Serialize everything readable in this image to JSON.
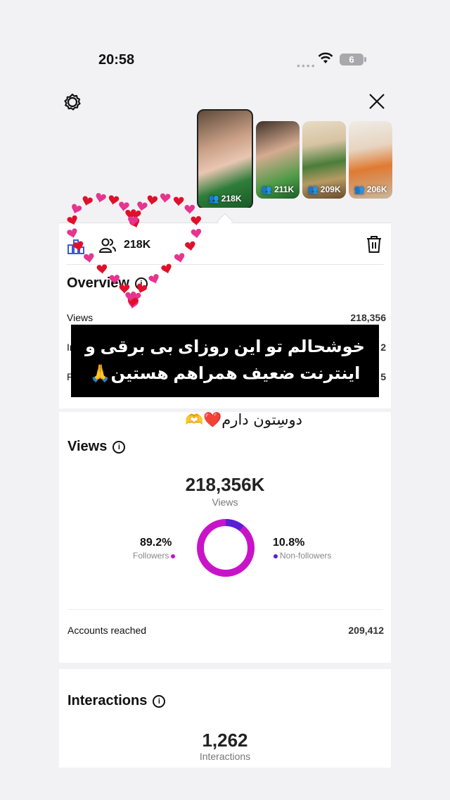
{
  "status_bar": {
    "time": "20:58",
    "signal": "••••",
    "battery": "6"
  },
  "colors": {
    "followers": "#c814c8",
    "non_followers": "#5a1fd6",
    "heart_red": "#e0102a",
    "heart_pink": "#e8338f"
  },
  "thumbnails": [
    {
      "count": "218K",
      "selected": true
    },
    {
      "count": "211K"
    },
    {
      "count": "209K"
    },
    {
      "count": "206K"
    }
  ],
  "tabbar": {
    "reached": "218K"
  },
  "overview": {
    "title": "Overview",
    "rows": [
      {
        "label": "Views",
        "value": "218,356"
      },
      {
        "label": "In",
        "value": "2"
      },
      {
        "label": "P",
        "value": "5"
      }
    ]
  },
  "caption": {
    "line1": "خوشحالم تو این روزای بی برقی و",
    "line2": "اینترنت ضعیف همراهم هستین🙏"
  },
  "handwritten": "دوسِتون دارم❤️🫶",
  "views_section": {
    "title": "Views",
    "total": "218,356K",
    "total_label": "Views",
    "followers_pct": "89.2%",
    "followers_label": "Followers",
    "followers_value": 89.2,
    "non_followers_pct": "10.8%",
    "non_followers_label": "Non-followers",
    "non_followers_value": 10.8,
    "accounts_reached_label": "Accounts reached",
    "accounts_reached_value": "209,412"
  },
  "interactions_section": {
    "title": "Interactions",
    "total": "1,262",
    "total_label": "Interactions"
  }
}
